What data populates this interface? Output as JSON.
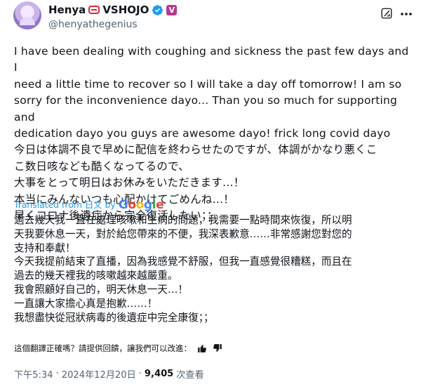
{
  "author": {
    "display_name": "Henya",
    "display_name_suffix": "VSHOJO",
    "handle": "@henyathegenius",
    "affiliation_badge": "V",
    "verified_icon": "verified-badge-icon",
    "colors": {
      "verified": "#1d9bf0",
      "affiliation": "#b7378d",
      "name_emoji": "#d7263d"
    }
  },
  "header_icons": {
    "grok": "grok-icon",
    "more": "more-icon"
  },
  "tweet": {
    "text": "I have been dealing with coughing and sickness the past few days and I\nneed a little time to recover so I will take a day off tomorrow! I am so\nsorry for the inconvenience dayo... Than you so much for supporting and\ndedication dayo you guys are awesome dayo! frick long covid dayo\n今日は体調不良で早めに配信を終わらせたのですが、体調がかなり悪くこ\nこ数日咳なども酷くなってるので、\n大事をとって明日はお休みをいただきます…！\n本当にみんないつも心配かけてごめんね…！\n早くコロナ後遺症から完全復活したい；；"
  },
  "translation": {
    "label": "Translated from 日文 by",
    "provider": "Google",
    "text": "過去幾天我一直在處理咳嗽和生病的問題，我需要一點時間來恢復，所以明\n天我要休息一天，對於給您帶來的不便，我深表歉意……非常感謝您對您的\n支持和奉獻！\n今天我提前結束了直播，因為我感覺不舒服，但我一直感覺很糟糕，而且在\n過去的幾天裡我的咳嗽越來越嚴重。\n我會照顧好自己的，明天休息一天…！\n一直讓大家擔心真是抱歉……！\n我想盡快從冠狀病毒的後遺症中完全康復；；",
    "feedback_prompt": "這個翻譯正確嗎？請提供回饋，讓我們可以改進：",
    "feedback_icons": [
      "thumbs-up-icon",
      "thumbs-down-icon"
    ]
  },
  "meta": {
    "time": "下午5:34",
    "separator": "·",
    "date": "2024年12月20日",
    "views_count": "9,405",
    "views_label": "次查看"
  }
}
